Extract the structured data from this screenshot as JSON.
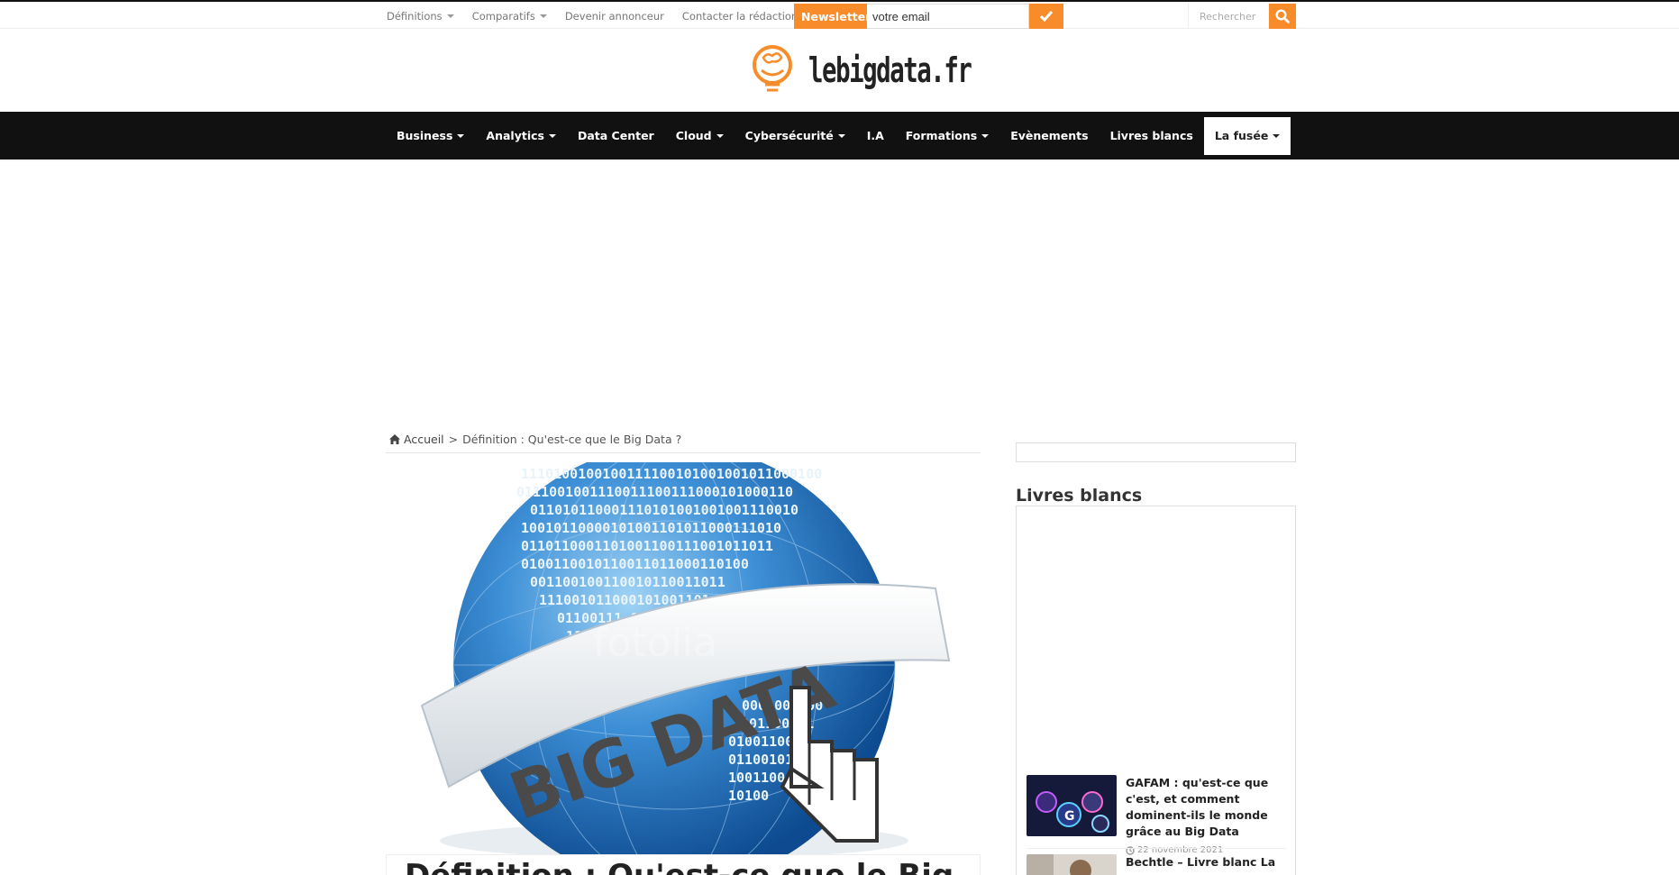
{
  "topbar": {
    "nav": [
      {
        "label": "Définitions",
        "dropdown": true
      },
      {
        "label": "Comparatifs",
        "dropdown": true
      },
      {
        "label": "Devenir annonceur",
        "dropdown": false
      },
      {
        "label": "Contacter la rédaction",
        "dropdown": false
      }
    ],
    "newsletter_label": "Newsletter",
    "newsletter_placeholder": "votre email",
    "search_placeholder": "Rechercher"
  },
  "logo": {
    "text": "lebigdata.fr"
  },
  "mainnav": {
    "items": [
      {
        "label": "Business",
        "dropdown": true
      },
      {
        "label": "Analytics",
        "dropdown": true
      },
      {
        "label": "Data Center",
        "dropdown": false
      },
      {
        "label": "Cloud",
        "dropdown": true
      },
      {
        "label": "Cybersécurité",
        "dropdown": true
      },
      {
        "label": "I.A",
        "dropdown": false
      },
      {
        "label": "Formations",
        "dropdown": true
      },
      {
        "label": "Evènements",
        "dropdown": false
      },
      {
        "label": "Livres blancs",
        "dropdown": false
      },
      {
        "label": "La fusée",
        "dropdown": true,
        "active": true
      }
    ]
  },
  "breadcrumb": {
    "home": "Accueil",
    "separator": ">",
    "current": "Définition : Qu'est-ce que le Big Data ?"
  },
  "article": {
    "image_text": "BIG DATA",
    "image_watermark": "fotolia",
    "title": "Définition : Qu'est-ce que le Big"
  },
  "sidebar": {
    "widget_title": "Livres blancs",
    "posts": [
      {
        "title": "GAFAM : qu'est-ce que c'est, et comment dominent-ils le monde grâce au Big Data",
        "date": "22 novembre 2021"
      },
      {
        "title": "Bechtle – Livre blanc La",
        "date": ""
      }
    ]
  },
  "colors": {
    "accent": "#f88c2b",
    "nav_bg": "#111111"
  }
}
